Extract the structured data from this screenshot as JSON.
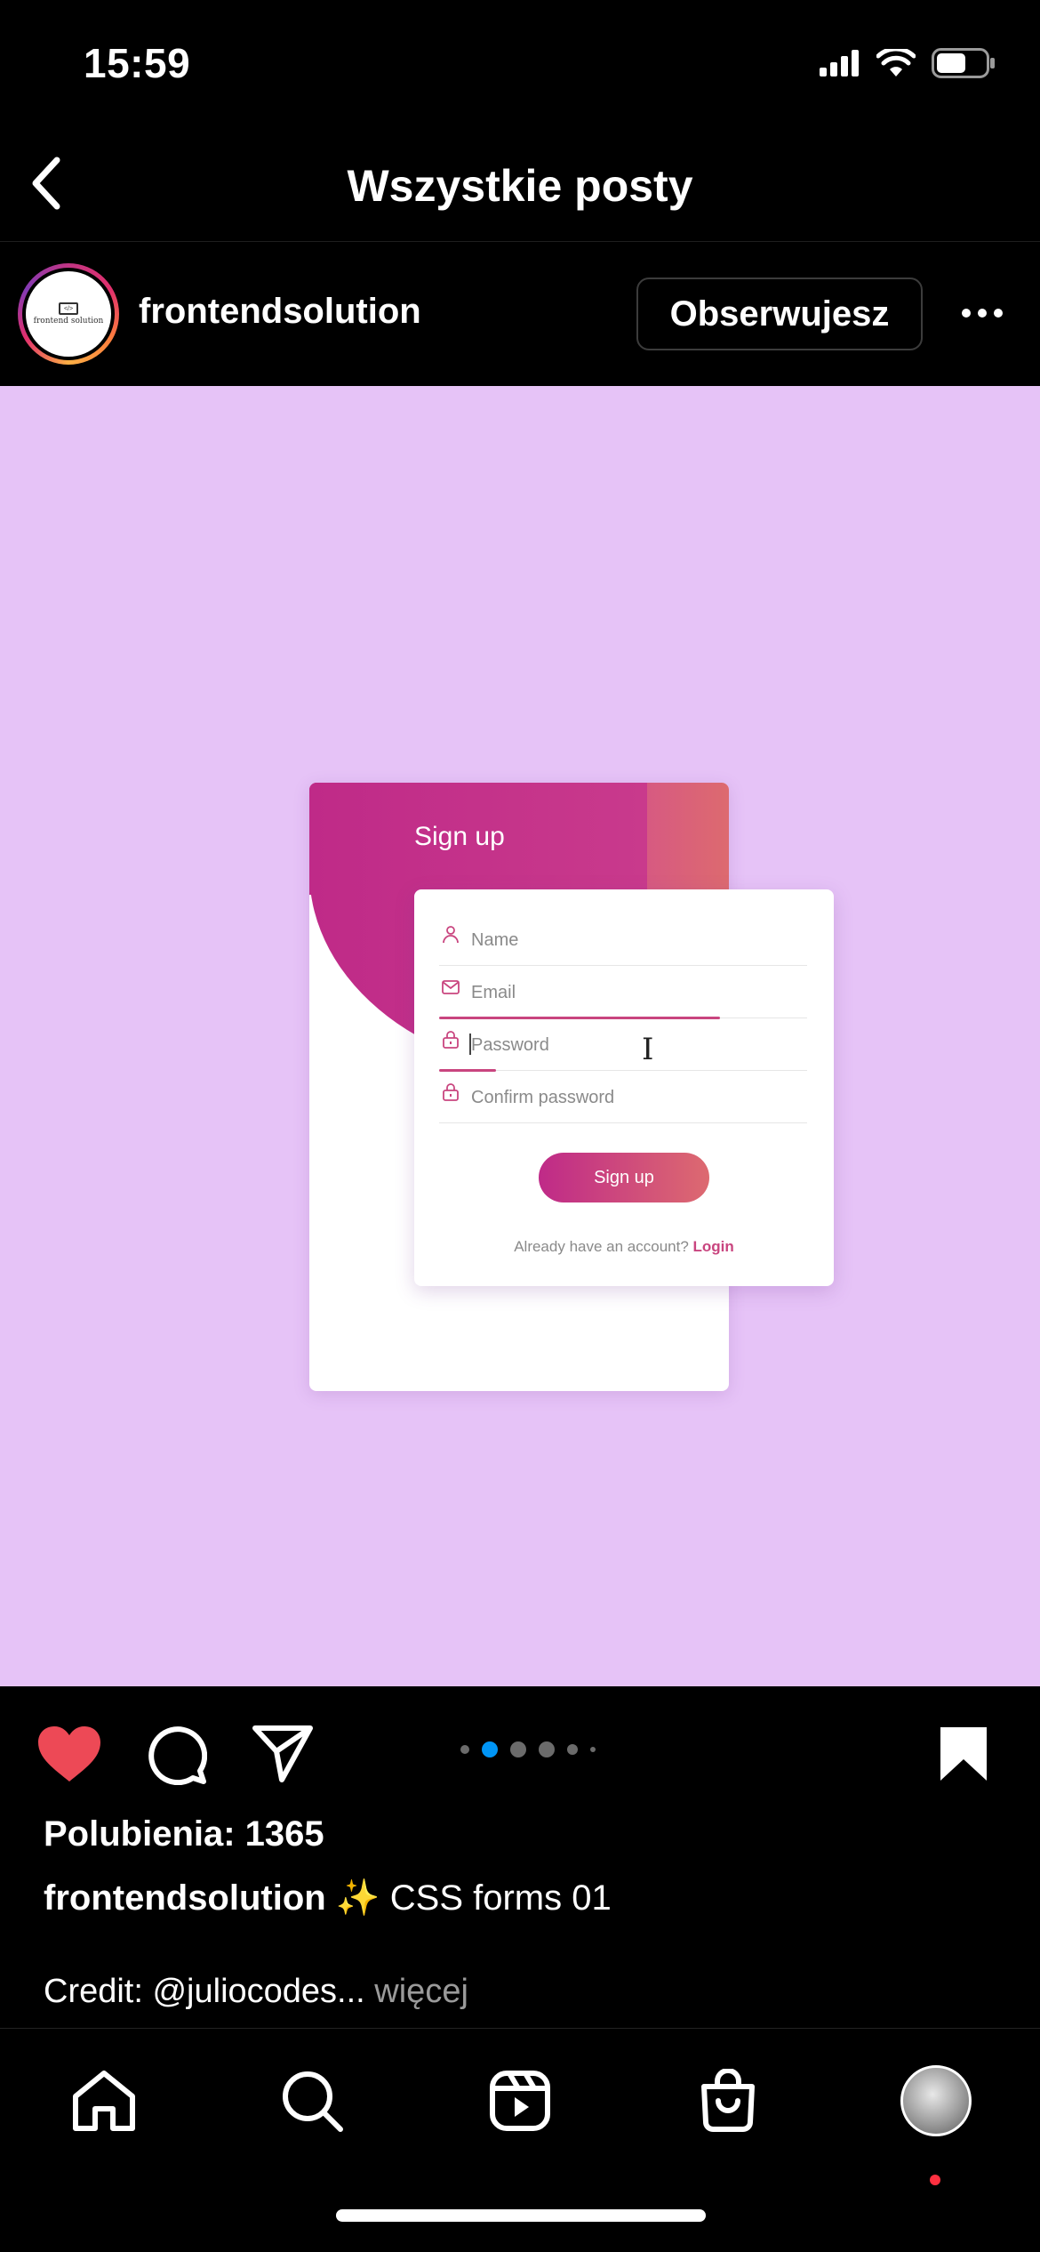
{
  "status_bar": {
    "time": "15:59"
  },
  "header": {
    "title": "Wszystkie posty"
  },
  "post": {
    "username": "frontendsolution",
    "follow_label": "Obserwujesz",
    "avatar_logo_text": "frontend solution",
    "image": {
      "card_title": "Sign up",
      "fields": [
        {
          "label": "Name",
          "icon": "user-icon"
        },
        {
          "label": "Email",
          "icon": "mail-icon"
        },
        {
          "label": "Password",
          "icon": "lock-icon"
        },
        {
          "label": "Confirm password",
          "icon": "lock-icon"
        }
      ],
      "button_label": "Sign up",
      "login_prompt": "Already have an account?",
      "login_link": "Login"
    },
    "carousel": {
      "total": 6,
      "active": 1
    },
    "likes": "Polubienia: 1365",
    "caption_user": "frontendsolution",
    "caption_text": "✨ CSS forms 01",
    "credit": "Credit: @juliocodes...",
    "more": "więcej"
  },
  "colors": {
    "background": "#000000",
    "post_bg": "#e6c3f7",
    "accent_gradient_start": "#bf2a88",
    "accent_gradient_end": "#dd6a70",
    "like_red": "#ed4956",
    "carousel_active": "#0095f6"
  },
  "tab_bar": {
    "items": [
      "home-icon",
      "search-icon",
      "reels-icon",
      "shop-icon",
      "profile-avatar"
    ]
  }
}
